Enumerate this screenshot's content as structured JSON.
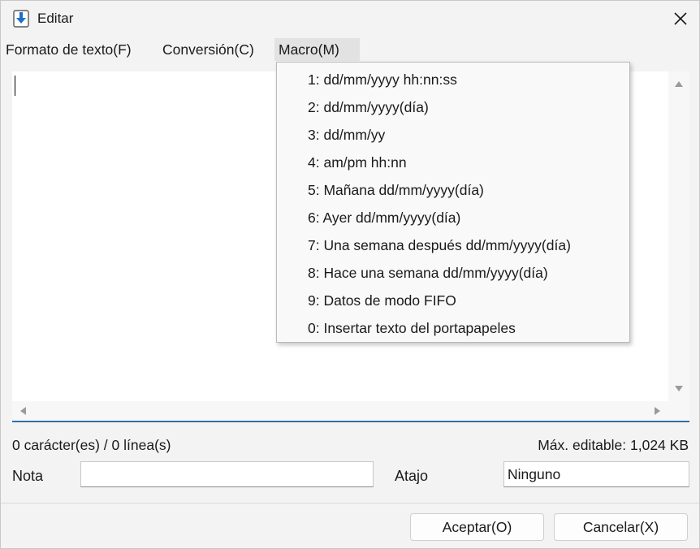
{
  "window": {
    "title": "Editar"
  },
  "menubar": {
    "items": [
      {
        "label": "Formato de texto(F)"
      },
      {
        "label": "Conversión(C)"
      },
      {
        "label": "Macro(M)"
      }
    ]
  },
  "macro_menu": {
    "items": [
      {
        "label": "1: dd/mm/yyyy hh:nn:ss"
      },
      {
        "label": "2: dd/mm/yyyy(día)"
      },
      {
        "label": "3: dd/mm/yy"
      },
      {
        "label": "4: am/pm hh:nn"
      },
      {
        "label": "5: Mañana dd/mm/yyyy(día)"
      },
      {
        "label": "6: Ayer dd/mm/yyyy(día)"
      },
      {
        "label": "7: Una semana después dd/mm/yyyy(día)"
      },
      {
        "label": "8: Hace una semana dd/mm/yyyy(día)"
      },
      {
        "label": "9: Datos de modo FIFO"
      },
      {
        "label": "0: Insertar texto del portapapeles"
      }
    ]
  },
  "status": {
    "count": "0 carácter(es) / 0 línea(s)",
    "max": "Máx. editable: 1,024 KB"
  },
  "form": {
    "note_label": "Nota",
    "note_value": "",
    "shortcut_label": "Atajo",
    "shortcut_value": "Ninguno"
  },
  "buttons": {
    "ok": "Aceptar(O)",
    "cancel": "Cancelar(X)"
  },
  "colors": {
    "accent": "#2f6fa8",
    "icon_blue": "#1e6fc8"
  }
}
